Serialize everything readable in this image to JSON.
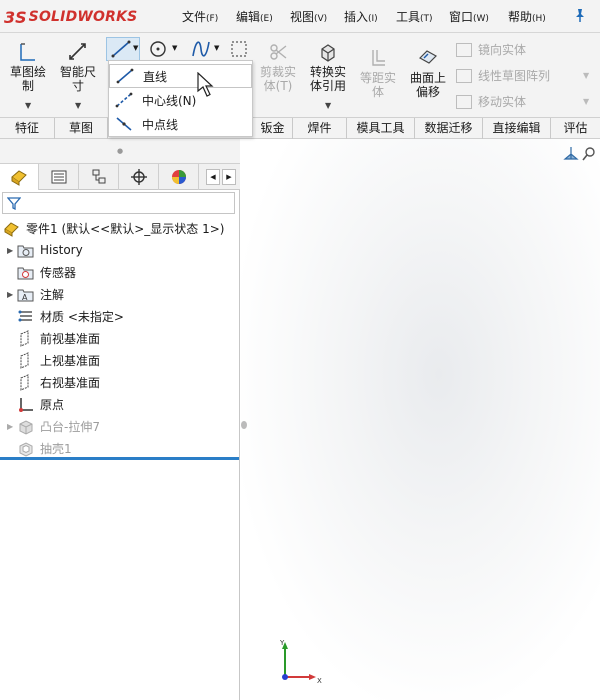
{
  "app": {
    "logo_ds": "3S",
    "logo_name": "SOLIDWORKS"
  },
  "menu": [
    {
      "label": "文件",
      "key": "(F)"
    },
    {
      "label": "编辑",
      "key": "(E)"
    },
    {
      "label": "视图",
      "key": "(V)"
    },
    {
      "label": "插入",
      "key": "(I)"
    },
    {
      "label": "工具",
      "key": "(T)"
    },
    {
      "label": "窗口",
      "key": "(W)"
    },
    {
      "label": "帮助",
      "key": "(H)"
    }
  ],
  "ribbon": {
    "sketch": {
      "line1": "草图绘",
      "line2": "制"
    },
    "smart_dim": {
      "line1": "智能尺",
      "line2": "寸"
    },
    "trim": {
      "line1": "剪裁实",
      "line2": "体(T)"
    },
    "convert": {
      "line1": "转换实",
      "line2": "体引用"
    },
    "offset": {
      "line1": "等距实",
      "line2": "体"
    },
    "surface_offset": {
      "line1": "曲面上",
      "line2": "偏移"
    },
    "mirror": "镜向实体",
    "linear_pattern": "线性草图阵列",
    "move": "移动实体"
  },
  "flyout": [
    {
      "label": "直线"
    },
    {
      "label": "中心线(N)"
    },
    {
      "label": "中点线"
    }
  ],
  "tabs": [
    "特征",
    "草图",
    "钣金",
    "焊件",
    "模具工具",
    "数据迁移",
    "直接编辑",
    "评估"
  ],
  "tree": {
    "root": "零件1  (默认<<默认>_显示状态 1>)",
    "items": [
      {
        "label": "History"
      },
      {
        "label": "传感器"
      },
      {
        "label": "注解"
      },
      {
        "label": "材质 <未指定>"
      },
      {
        "label": "前视基准面"
      },
      {
        "label": "上视基准面"
      },
      {
        "label": "右视基准面"
      },
      {
        "label": "原点"
      },
      {
        "label": "凸台-拉伸7"
      },
      {
        "label": "抽壳1"
      }
    ]
  },
  "triad": {
    "x": "X",
    "y": "Y"
  },
  "colors": {
    "brand": "#d0312d",
    "accent": "#2a7ec7",
    "disabled": "#a9a9a9"
  }
}
